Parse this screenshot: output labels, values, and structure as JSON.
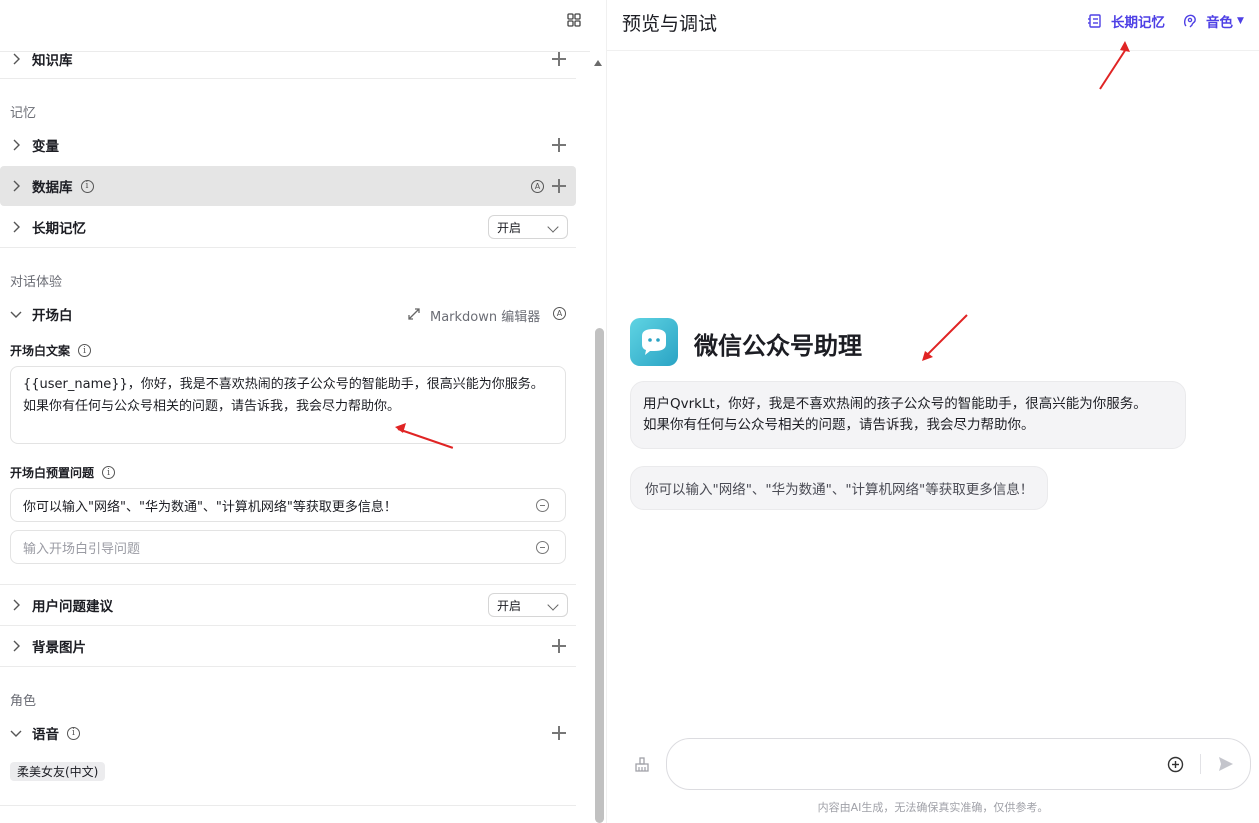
{
  "left": {
    "sections": {
      "memory": "记忆",
      "experience": "对话体验",
      "role": "角色"
    },
    "rows": {
      "knowledge": "知识库",
      "variables": "变量",
      "database": "数据库",
      "long_memory": "长期记忆",
      "opening": "开场白",
      "user_suggest": "用户问题建议",
      "background": "背景图片",
      "voice": "语音"
    },
    "long_memory_value": "开启",
    "user_suggest_value": "开启",
    "markdown_editor": "Markdown 编辑器",
    "opening_text_label": "开场白文案",
    "opening_text_line1": "{{user_name}}，你好，我是不喜欢热闹的孩子公众号的智能助手，很高兴能为你服务。",
    "opening_text_line2": "如果你有任何与公众号相关的问题，请告诉我，我会尽力帮助你。",
    "preset_label": "开场白预置问题",
    "preset_question": "你可以输入\"网络\"、\"华为数通\"、\"计算机网络\"等获取更多信息！",
    "preset_placeholder": "输入开场白引导问题",
    "voice_tag": "柔美女友(中文)"
  },
  "right": {
    "title": "预览与调试",
    "long_memory_btn": "长期记忆",
    "voice_btn": "音色",
    "bot_name": "微信公众号助理",
    "greeting_line1": "用户QvrkLt，你好，我是不喜欢热闹的孩子公众号的智能助手，很高兴能为你服务。",
    "greeting_line2": "如果你有任何与公众号相关的问题，请告诉我，我会尽力帮助你。",
    "suggestion": "你可以输入\"网络\"、\"华为数通\"、\"计算机网络\"等获取更多信息！",
    "disclaimer": "内容由AI生成，无法确保真实准确，仅供参考。"
  },
  "colors": {
    "accent": "#4e40e5",
    "annotation": "#e02424",
    "highlight_row": "#e5e5e5"
  },
  "icons": [
    "grid-icon",
    "chevron-right-icon",
    "chevron-down-icon",
    "plus-icon",
    "info-icon",
    "auto-icon",
    "expand-icon",
    "minus-circle-icon",
    "memory-icon",
    "voice-icon",
    "broom-icon",
    "add-circle-icon",
    "send-icon",
    "bot-avatar"
  ]
}
